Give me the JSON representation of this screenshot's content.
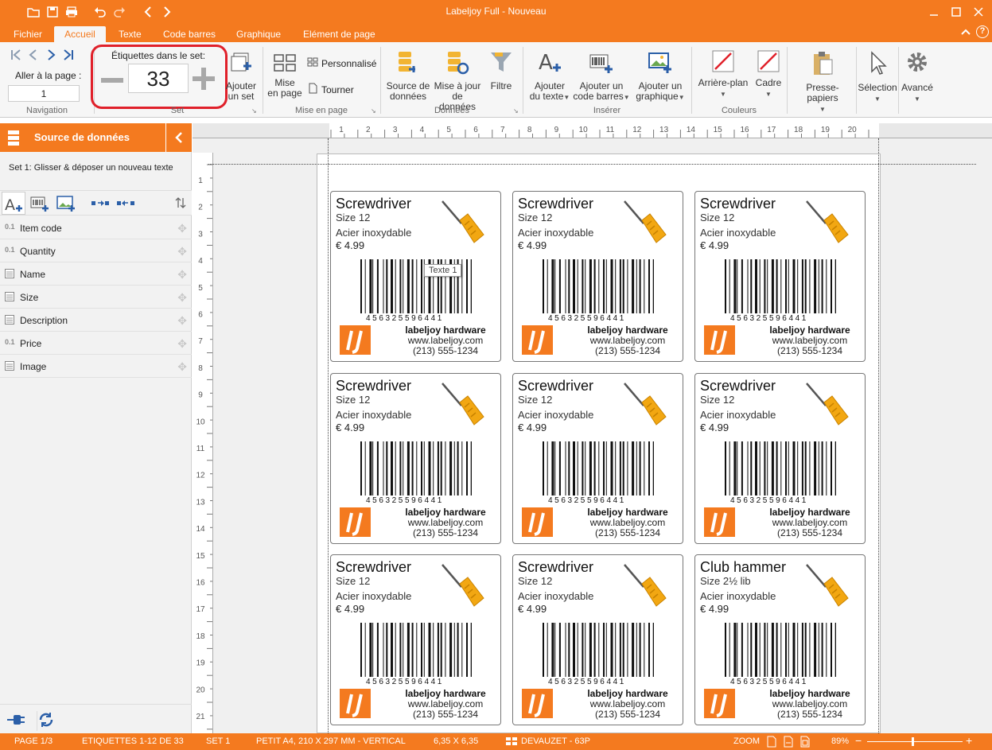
{
  "window": {
    "title": "Labeljoy Full - Nouveau"
  },
  "menu": {
    "tabs": [
      "Fichier",
      "Accueil",
      "Texte",
      "Code barres",
      "Graphique",
      "Elément de page"
    ],
    "active": "Accueil"
  },
  "ribbon": {
    "navigation": {
      "goto_label": "Aller à la page :",
      "page_value": "1",
      "group": "Navigation"
    },
    "set": {
      "label": "Étiquettes dans le set:",
      "count": "33",
      "add_set_line1": "Ajouter",
      "add_set_line2": "un set",
      "group": "Set"
    },
    "page_layout": {
      "layout_line1": "Mise",
      "layout_line2": "en page",
      "custom": "Personnalisé",
      "rotate": "Tourner",
      "group": "Mise en page"
    },
    "data": {
      "source_line1": "Source de",
      "source_line2": "données",
      "update_line1": "Mise à jour",
      "update_line2": "de données",
      "filter": "Filtre",
      "group": "Données"
    },
    "insert": {
      "text_line1": "Ajouter",
      "text_line2": "du texte",
      "barcode_line1": "Ajouter un",
      "barcode_line2": "code barres",
      "graphic_line1": "Ajouter un",
      "graphic_line2": "graphique",
      "group": "Insérer"
    },
    "colors": {
      "background": "Arrière-plan",
      "frame": "Cadre",
      "group": "Couleurs"
    },
    "clipboard": {
      "label": "Presse-papiers"
    },
    "selection": {
      "label": "Sélection"
    },
    "advanced": {
      "label": "Avancé"
    }
  },
  "sidebar": {
    "title": "Source de données",
    "hint": "Set 1: Glisser & déposer un nouveau texte",
    "fields": [
      {
        "type": "0.1",
        "name": "Item code"
      },
      {
        "type": "0.1",
        "name": "Quantity"
      },
      {
        "type": "txt",
        "name": "Name"
      },
      {
        "type": "txt",
        "name": "Size"
      },
      {
        "type": "txt",
        "name": "Description"
      },
      {
        "type": "0.1",
        "name": "Price"
      },
      {
        "type": "txt",
        "name": "Image"
      }
    ]
  },
  "rulers": {
    "h": [
      "1",
      "2",
      "3",
      "4",
      "5",
      "6",
      "7",
      "8",
      "9",
      "10",
      "11",
      "12",
      "13",
      "14",
      "15",
      "16",
      "17",
      "18",
      "19",
      "20"
    ],
    "v": [
      "1",
      "2",
      "3",
      "4",
      "5",
      "6",
      "7",
      "8",
      "9",
      "10",
      "11",
      "12",
      "13",
      "14",
      "15",
      "16",
      "17",
      "18",
      "19",
      "20",
      "21"
    ]
  },
  "labels": [
    {
      "name": "Screwdriver",
      "size": "Size 12",
      "material": "Acier inoxydable",
      "price": "€ 4.99",
      "barcode": "456325596441",
      "company": "labeljoy hardware",
      "web": "www.labeljoy.com",
      "phone": "(213) 555-1234"
    },
    {
      "name": "Screwdriver",
      "size": "Size 12",
      "material": "Acier inoxydable",
      "price": "€ 4.99",
      "barcode": "456325596441",
      "company": "labeljoy hardware",
      "web": "www.labeljoy.com",
      "phone": "(213) 555-1234"
    },
    {
      "name": "Screwdriver",
      "size": "Size 12",
      "material": "Acier inoxydable",
      "price": "€ 4.99",
      "barcode": "456325596441",
      "company": "labeljoy hardware",
      "web": "www.labeljoy.com",
      "phone": "(213) 555-1234"
    },
    {
      "name": "Screwdriver",
      "size": "Size 12",
      "material": "Acier inoxydable",
      "price": "€ 4.99",
      "barcode": "456325596441",
      "company": "labeljoy hardware",
      "web": "www.labeljoy.com",
      "phone": "(213) 555-1234"
    },
    {
      "name": "Screwdriver",
      "size": "Size 12",
      "material": "Acier inoxydable",
      "price": "€ 4.99",
      "barcode": "456325596441",
      "company": "labeljoy hardware",
      "web": "www.labeljoy.com",
      "phone": "(213) 555-1234"
    },
    {
      "name": "Screwdriver",
      "size": "Size 12",
      "material": "Acier inoxydable",
      "price": "€ 4.99",
      "barcode": "456325596441",
      "company": "labeljoy hardware",
      "web": "www.labeljoy.com",
      "phone": "(213) 555-1234"
    },
    {
      "name": "Screwdriver",
      "size": "Size 12",
      "material": "Acier inoxydable",
      "price": "€ 4.99",
      "barcode": "456325596441",
      "company": "labeljoy hardware",
      "web": "www.labeljoy.com",
      "phone": "(213) 555-1234"
    },
    {
      "name": "Screwdriver",
      "size": "Size 12",
      "material": "Acier inoxydable",
      "price": "€ 4.99",
      "barcode": "456325596441",
      "company": "labeljoy hardware",
      "web": "www.labeljoy.com",
      "phone": "(213) 555-1234"
    },
    {
      "name": "Club hammer",
      "size": "Size 2½ lib",
      "material": "Acier inoxydable",
      "price": "€ 4.99",
      "barcode": "456325596441",
      "company": "labeljoy hardware",
      "web": "www.labeljoy.com",
      "phone": "(213) 555-1234"
    }
  ],
  "tooltip": "Texte 1",
  "status": {
    "page": "PAGE 1/3",
    "labels": "ETIQUETTES 1-12 DE 33",
    "set": "SET 1",
    "paper": "PETIT A4, 210 X 297 MM - VERTICAL",
    "label_size": "6,35 X 6,35",
    "template": "DEVAUZET - 63P",
    "zoom_label": "ZOOM",
    "zoom_value": "89%"
  },
  "colors": {
    "accent": "#f47a1f",
    "highlight": "#e0202a"
  }
}
